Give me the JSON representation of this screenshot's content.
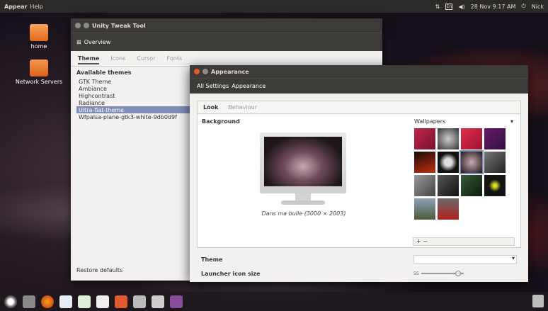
{
  "top_panel": {
    "app_menu": "Appear",
    "help_menu": "Help",
    "keyboard_indicator": "En",
    "datetime": "28 Nov 9:17 AM",
    "user": "Nick"
  },
  "desktop": {
    "icons": [
      {
        "label": "home",
        "icon": "home-folder-icon"
      },
      {
        "label": "Network Servers",
        "icon": "network-folder-icon"
      }
    ]
  },
  "unity_tweak": {
    "title": "Unity Tweak Tool",
    "overview": "Overview",
    "tabs": [
      "Theme",
      "Icons",
      "Cursor",
      "Fonts"
    ],
    "heading": "Available themes",
    "themes": [
      "GTK Theme",
      "Ambiance",
      "Highcontrast",
      "Radiance",
      "Ultra-flat-theme",
      "Wfpalsa-plane-gtk3-white-9db0d9f"
    ],
    "selected_theme": 4,
    "restore": "Restore defaults"
  },
  "appearance": {
    "title": "Appearance",
    "breadcrumb_all": "All Settings",
    "breadcrumb_current": "Appearance",
    "tabs": [
      "Look",
      "Behaviour"
    ],
    "background_label": "Background",
    "caption": "Dans ma bulle (3000 × 2003)",
    "wallpapers_label": "Wallpapers",
    "add_remove": "+ −",
    "theme_label": "Theme",
    "launcher_icon_size_label": "Launcher icon size",
    "launcher_icon_size_value": "55"
  },
  "colors": {
    "accent": "#7f8eb8",
    "titlebar": "#3c3b37",
    "close": "#e05a2b"
  }
}
